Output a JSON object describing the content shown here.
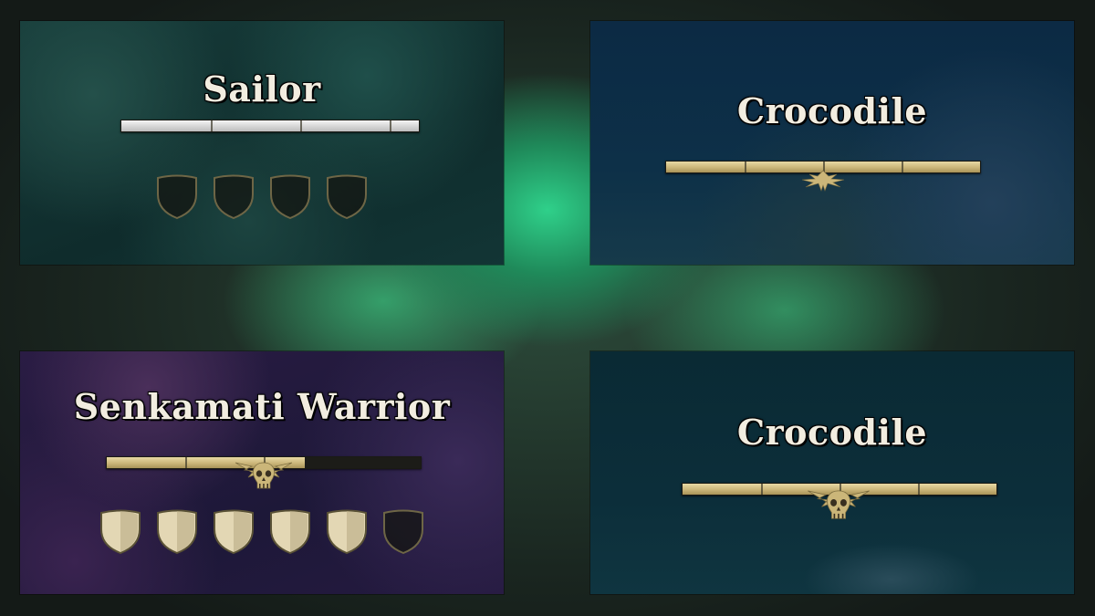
{
  "panels": [
    {
      "name": "Sailor",
      "health": 1.0,
      "bar_style": "silver",
      "emblem": "none",
      "armor": {
        "filled": 0,
        "total": 4
      }
    },
    {
      "name": "Crocodile",
      "health": 1.0,
      "bar_style": "gold",
      "emblem": "small-wing-crest-icon",
      "armor": {
        "filled": 0,
        "total": 0
      }
    },
    {
      "name": "Senkamati Warrior",
      "health": 0.63,
      "bar_style": "gold",
      "emblem": "skull-crest-icon",
      "armor": {
        "filled": 5,
        "total": 6
      }
    },
    {
      "name": "Crocodile",
      "health": 1.0,
      "bar_style": "gold",
      "emblem": "skull-crest-icon",
      "armor": {
        "filled": 0,
        "total": 0
      }
    }
  ],
  "colors": {
    "silver": "#dcdcdc",
    "gold": "#cbb679",
    "shield_filled": "#e3d7b4",
    "shield_empty_dark": "#141612",
    "shield_empty_outline": "#6e6646"
  }
}
